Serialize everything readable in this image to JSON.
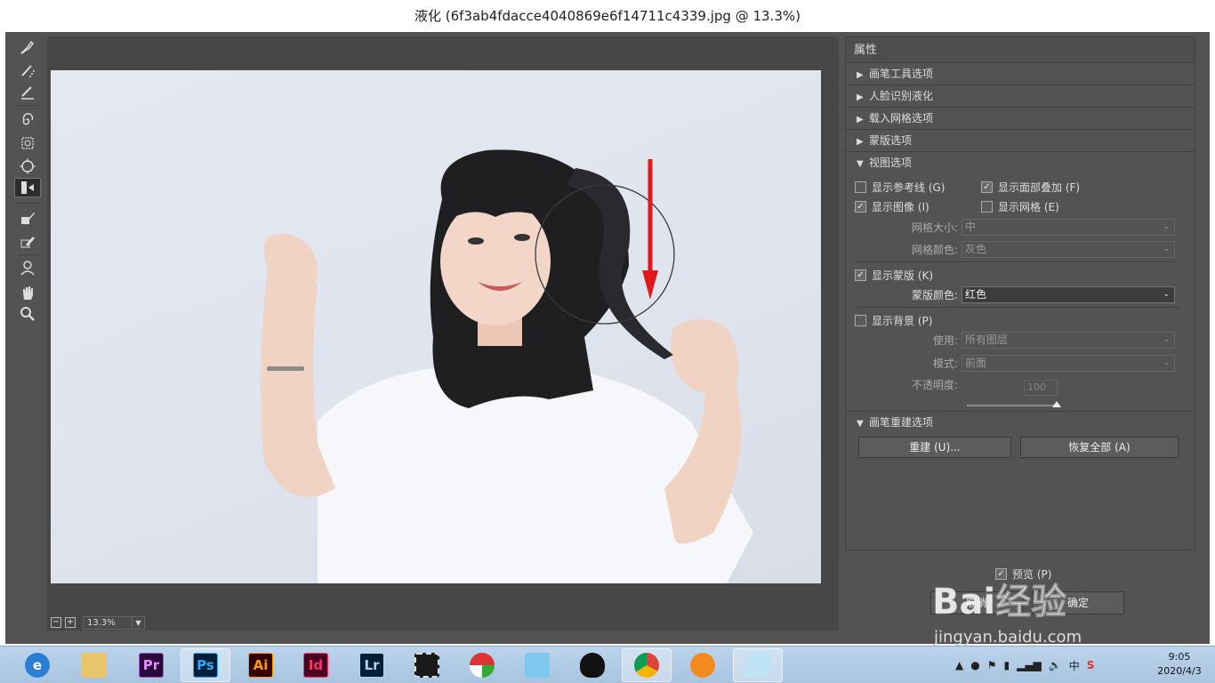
{
  "window": {
    "title": "液化 (6f3ab4fdacce4040869e6f14711c4339.jpg @ 13.3%)"
  },
  "canvas": {
    "zoom_value": "13.3%",
    "zoom_out_label": "−",
    "zoom_in_label": "+"
  },
  "properties": {
    "header": "属性",
    "sections": [
      {
        "label": "画笔工具选项",
        "expanded": false
      },
      {
        "label": "人脸识别液化",
        "expanded": false
      },
      {
        "label": "载入网格选项",
        "expanded": false
      },
      {
        "label": "蒙版选项",
        "expanded": false
      },
      {
        "label": "视图选项",
        "expanded": true
      }
    ],
    "view": {
      "show_guides": {
        "label": "显示参考线 (G)",
        "checked": false
      },
      "show_face_overlay": {
        "label": "显示面部叠加 (F)",
        "checked": true
      },
      "show_image": {
        "label": "显示图像 (I)",
        "checked": true
      },
      "show_mesh": {
        "label": "显示网格 (E)",
        "checked": false
      },
      "mesh_size_label": "网格大小:",
      "mesh_size_value": "中",
      "mesh_color_label": "网格颜色:",
      "mesh_color_value": "灰色",
      "show_mask": {
        "label": "显示蒙版 (K)",
        "checked": true
      },
      "mask_color_label": "蒙版颜色:",
      "mask_color_value": "红色",
      "show_backdrop": {
        "label": "显示背景 (P)",
        "checked": false
      },
      "use_label": "使用:",
      "use_value": "所有图层",
      "mode_label": "模式:",
      "mode_value": "前面",
      "opacity_label": "不透明度:",
      "opacity_value": "100"
    },
    "rebuild_section": "画笔重建选项",
    "rebuild_button": "重建 (U)...",
    "restore_all_button": "恢复全部 (A)"
  },
  "footer": {
    "preview": {
      "label": "预览 (P)",
      "checked": true
    },
    "cancel_button": "取消",
    "ok_button": "确定"
  },
  "tools": [
    "forward-warp-icon",
    "reconstruct-icon",
    "smooth-icon",
    "twirl-icon",
    "pucker-icon",
    "bloat-icon",
    "push-left-icon",
    "freeze-mask-icon",
    "thaw-mask-icon",
    "face-tool-icon",
    "hand-icon",
    "zoom-icon"
  ],
  "taskbar": {
    "apps": [
      {
        "name": "ie",
        "label": "e",
        "bg": "#2a7fd4",
        "fg": "#ffffff"
      },
      {
        "name": "explorer",
        "label": "",
        "bg": "#e8c46a",
        "fg": "#333"
      },
      {
        "name": "premiere",
        "label": "Pr",
        "bg": "#2a0a3a",
        "fg": "#e38dff"
      },
      {
        "name": "photoshop",
        "label": "Ps",
        "bg": "#001e36",
        "fg": "#31a8ff"
      },
      {
        "name": "illustrator",
        "label": "Ai",
        "bg": "#330000",
        "fg": "#ff9a00"
      },
      {
        "name": "indesign",
        "label": "Id",
        "bg": "#49021f",
        "fg": "#ff3366"
      },
      {
        "name": "lightroom",
        "label": "Lr",
        "bg": "#001e36",
        "fg": "#add5ec"
      },
      {
        "name": "video",
        "label": "",
        "bg": "#1a1a1a",
        "fg": "#fff"
      },
      {
        "name": "app-umbrella",
        "label": "",
        "bg": "#f4f4f4",
        "fg": "#c00"
      },
      {
        "name": "app-mail",
        "label": "",
        "bg": "#7fc8ee",
        "fg": "#fff"
      },
      {
        "name": "qq",
        "label": "",
        "bg": "transparent",
        "fg": "#000"
      },
      {
        "name": "chrome",
        "label": "",
        "bg": "transparent",
        "fg": "#000"
      },
      {
        "name": "app-orange",
        "label": "",
        "bg": "#f28a1d",
        "fg": "#fff"
      },
      {
        "name": "app-notes",
        "label": "",
        "bg": "#bde3f5",
        "fg": "#fff"
      }
    ],
    "tray_ime": "中",
    "clock_time": "9:05",
    "clock_date": "2020/4/3"
  },
  "watermark": {
    "text": "Bai经验",
    "url": "jingyan.baidu.com"
  }
}
